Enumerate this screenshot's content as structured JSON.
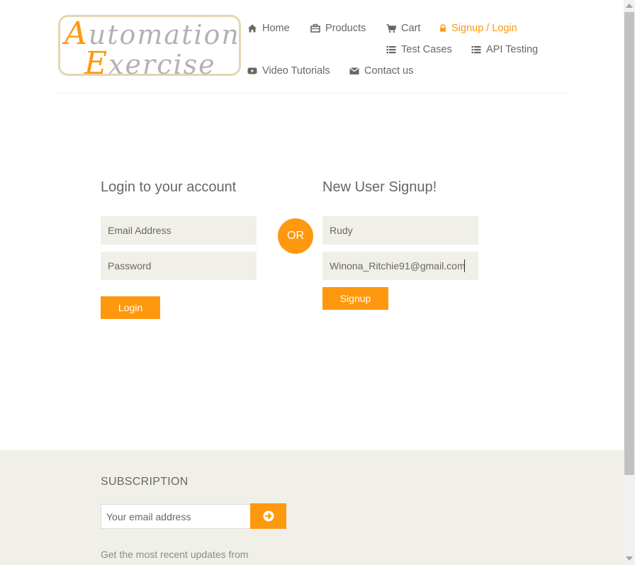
{
  "brand": {
    "logo_line1_cap": "A",
    "logo_line1_rest": "utomation",
    "logo_line2_cap": "E",
    "logo_line2_rest": "xercise"
  },
  "nav": {
    "home": "Home",
    "products": "Products",
    "cart": "Cart",
    "signup_login": "Signup / Login",
    "test_cases": "Test Cases",
    "api_testing": "API Testing",
    "video_tutorials": "Video Tutorials",
    "contact_us": "Contact us"
  },
  "login": {
    "title": "Login to your account",
    "email_placeholder": "Email Address",
    "password_placeholder": "Password",
    "button": "Login"
  },
  "divider": "OR",
  "signup": {
    "title": "New User Signup!",
    "name_value": "Rudy",
    "email_value": "Winona_Ritchie91@gmail.com",
    "button": "Signup"
  },
  "footer": {
    "title": "SUBSCRIPTION",
    "email_placeholder": "Your email address",
    "description": "Get the most recent updates from"
  },
  "colors": {
    "accent": "#fe980f",
    "text": "#696763",
    "field_bg": "#f0f0e9"
  },
  "icons": [
    "home-icon",
    "briefcase-icon",
    "cart-icon",
    "lock-icon",
    "list-icon",
    "youtube-icon",
    "envelope-icon",
    "arrow-circle-right-icon"
  ]
}
